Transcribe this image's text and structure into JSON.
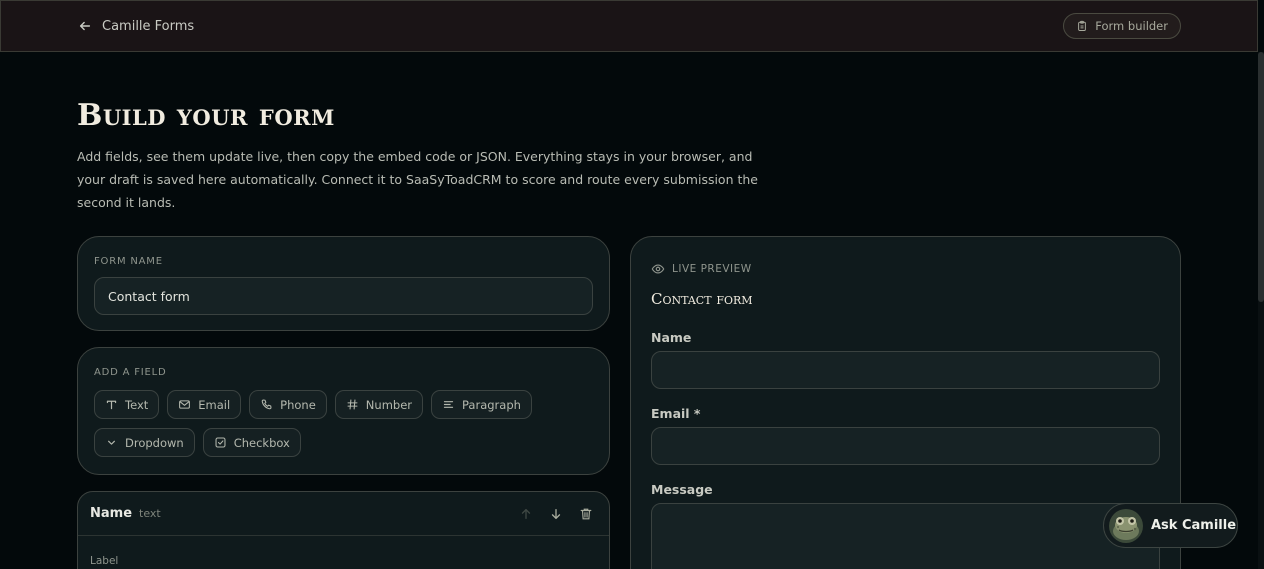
{
  "topbar": {
    "brand_label": "Camille Forms",
    "pill_label": "Form builder"
  },
  "page": {
    "title": "Build your form",
    "description": "Add fields, see them update live, then copy the embed code or JSON. Everything stays in your browser, and your draft is saved here automatically. Connect it to SaaSyToadCRM to score and route every submission the second it lands."
  },
  "form_name": {
    "label": "Form name",
    "value": "Contact form"
  },
  "add_field": {
    "label": "Add a field",
    "chips": [
      {
        "label": "Text",
        "icon": "text-icon"
      },
      {
        "label": "Email",
        "icon": "mail-icon"
      },
      {
        "label": "Phone",
        "icon": "phone-icon"
      },
      {
        "label": "Number",
        "icon": "hash-icon"
      },
      {
        "label": "Paragraph",
        "icon": "paragraph-icon"
      },
      {
        "label": "Dropdown",
        "icon": "chevron-down-icon"
      },
      {
        "label": "Checkbox",
        "icon": "checkbox-icon"
      }
    ]
  },
  "field_editor": {
    "name": "Name",
    "type": "text",
    "label_caption": "Label"
  },
  "preview": {
    "tag": "Live preview",
    "title": "Contact form",
    "fields": [
      {
        "label": "Name"
      },
      {
        "label": "Email *"
      },
      {
        "label": "Message"
      }
    ]
  },
  "assistant": {
    "label": "Ask Camille"
  },
  "colors": {
    "background": "#03090b",
    "topbar": "#1a1416",
    "card": "#0f1a1c",
    "accent_text": "#f1ece0"
  }
}
